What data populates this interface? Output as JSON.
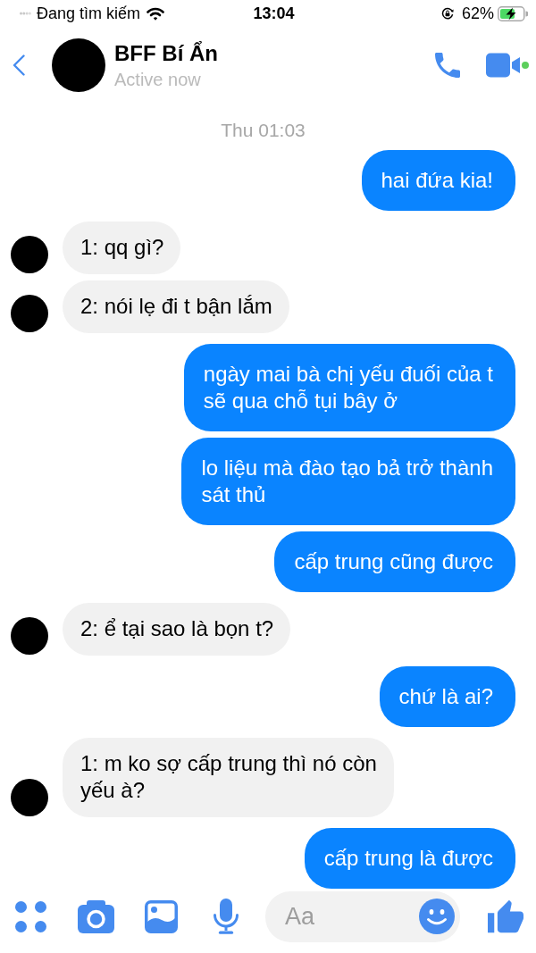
{
  "status_bar": {
    "carrier": "Đang tìm kiếm",
    "time": "13:04",
    "battery": "62%"
  },
  "header": {
    "name": "BFF Bí Ẩn",
    "status": "Active now"
  },
  "conversation": {
    "timestamp": "Thu 01:03",
    "messages": [
      {
        "kind": "outgoing",
        "text": "hai đứa kia!"
      },
      {
        "kind": "incoming",
        "text": "1: qq gì?"
      },
      {
        "kind": "incoming",
        "text": "2: nói lẹ đi t bận lắm"
      },
      {
        "kind": "outgoing",
        "text": "ngày mai bà chị yếu đuối của t\nsẽ qua chỗ tụi bây ở"
      },
      {
        "kind": "outgoing",
        "text": "lo liệu mà đào tạo bả trở thành\nsát thủ"
      },
      {
        "kind": "outgoing",
        "text": "cấp trung cũng được"
      },
      {
        "kind": "incoming",
        "text": "2: ể tại sao là bọn t?"
      },
      {
        "kind": "outgoing",
        "text": "chứ là ai?"
      },
      {
        "kind": "incoming",
        "text": "1: m ko sợ cấp trung thì nó còn\nyếu à?"
      },
      {
        "kind": "outgoing",
        "text": "cấp trung là được"
      }
    ]
  },
  "composer": {
    "placeholder": "Aa"
  }
}
